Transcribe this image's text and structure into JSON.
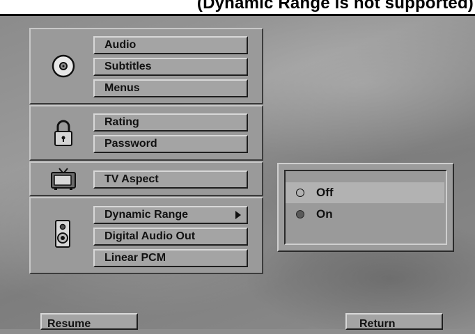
{
  "title": "(Dynamic Range is not supported)",
  "menu": {
    "disc_group": [
      "Audio",
      "Subtitles",
      "Menus"
    ],
    "lock_group": [
      "Rating",
      "Password"
    ],
    "tv_group": [
      "TV Aspect"
    ],
    "speaker_group": [
      "Dynamic Range",
      "Digital Audio Out",
      "Linear PCM"
    ]
  },
  "popup": {
    "options": [
      {
        "label": "Off",
        "selected": true
      },
      {
        "label": "On",
        "selected": false
      }
    ]
  },
  "footer": {
    "resume_label": "Resume",
    "return_label": "Return"
  },
  "icons": {
    "disc": "disc-icon",
    "lock": "padlock-icon",
    "tv": "television-icon",
    "speaker": "speaker-icon",
    "submenu": "triangle-right-icon"
  }
}
